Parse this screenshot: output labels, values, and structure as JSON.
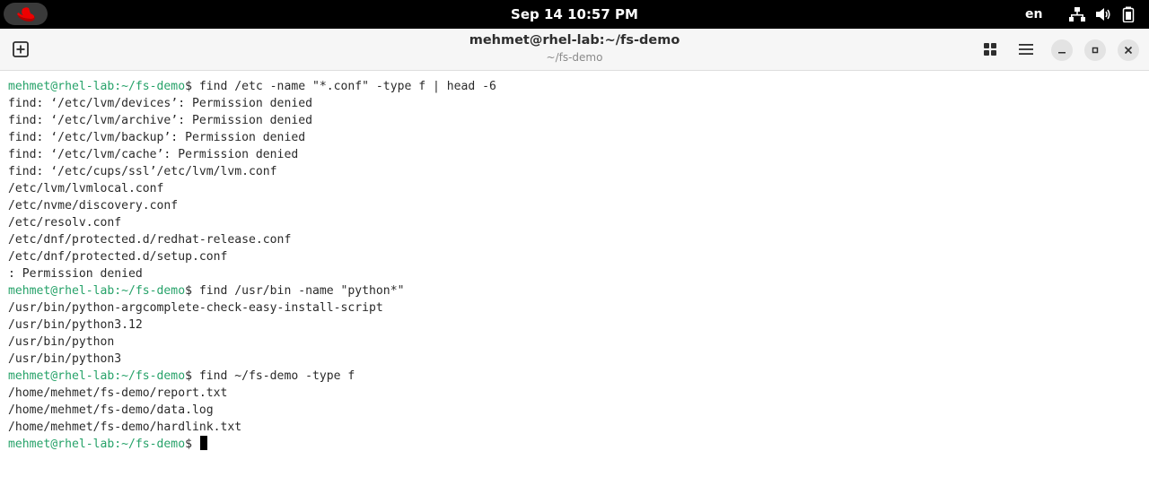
{
  "topbar": {
    "clock": "Sep 14  10:57 PM",
    "language": "en"
  },
  "window": {
    "title": "mehmet@rhel-lab:~/fs-demo",
    "subtitle": "~/fs-demo"
  },
  "terminal": {
    "prompt": "mehmet@rhel-lab:~/fs-demo",
    "lines": [
      {
        "prompt": "mehmet@rhel-lab:~/fs-demo",
        "text": "$ find /etc -name \"*.conf\" -type f | head -6"
      },
      {
        "text": "find: ‘/etc/lvm/devices’: Permission denied"
      },
      {
        "text": "find: ‘/etc/lvm/archive’: Permission denied"
      },
      {
        "text": "find: ‘/etc/lvm/backup’: Permission denied"
      },
      {
        "text": "find: ‘/etc/lvm/cache’: Permission denied"
      },
      {
        "text": "find: ‘/etc/cups/ssl’/etc/lvm/lvm.conf"
      },
      {
        "text": "/etc/lvm/lvmlocal.conf"
      },
      {
        "text": "/etc/nvme/discovery.conf"
      },
      {
        "text": "/etc/resolv.conf"
      },
      {
        "text": "/etc/dnf/protected.d/redhat-release.conf"
      },
      {
        "text": "/etc/dnf/protected.d/setup.conf"
      },
      {
        "text": ": Permission denied"
      },
      {
        "prompt": "mehmet@rhel-lab:~/fs-demo",
        "text": "$ find /usr/bin -name \"python*\""
      },
      {
        "text": "/usr/bin/python-argcomplete-check-easy-install-script"
      },
      {
        "text": "/usr/bin/python3.12"
      },
      {
        "text": "/usr/bin/python"
      },
      {
        "text": "/usr/bin/python3"
      },
      {
        "prompt": "mehmet@rhel-lab:~/fs-demo",
        "text": "$ find ~/fs-demo -type f"
      },
      {
        "text": "/home/mehmet/fs-demo/report.txt"
      },
      {
        "text": "/home/mehmet/fs-demo/data.log"
      },
      {
        "text": "/home/mehmet/fs-demo/hardlink.txt"
      },
      {
        "prompt": "mehmet@rhel-lab:~/fs-demo",
        "text": "$ ",
        "cursor": true
      }
    ]
  },
  "colors": {
    "prompt": "#26a269",
    "topbar": "#000000",
    "headerbar": "#f6f6f6",
    "redhat_logo": "#ee0000"
  },
  "icons": {
    "activities": "redhat-logo-icon",
    "network": "network-icon",
    "volume": "volume-icon",
    "battery": "battery-icon",
    "new_tab": "new-tab-icon",
    "tab_overview": "grid-icon",
    "menu": "hamburger-menu-icon",
    "minimize": "minimize-icon",
    "maximize": "maximize-icon",
    "close": "close-icon"
  }
}
